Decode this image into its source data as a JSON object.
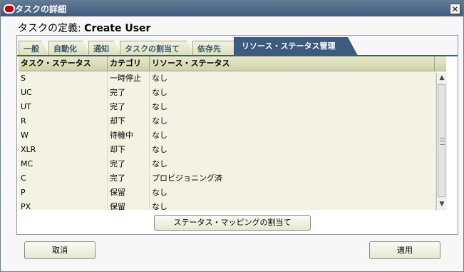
{
  "window": {
    "title": "タスクの詳細",
    "close_label": "×"
  },
  "heading": {
    "prefix": "タスクの定義: ",
    "name": "Create User"
  },
  "tabs": [
    {
      "label": "一般",
      "active": false
    },
    {
      "label": "自動化",
      "active": false
    },
    {
      "label": "通知",
      "active": false
    },
    {
      "label": "タスクの割当て",
      "active": false
    },
    {
      "label": "依存先",
      "active": false
    },
    {
      "label": "リソース・ステータス管理",
      "active": true
    }
  ],
  "table": {
    "columns": [
      "タスク・ステータス",
      "カテゴリ",
      "リソース・ステータス"
    ],
    "rows": [
      [
        "S",
        "一時停止",
        "なし"
      ],
      [
        "UC",
        "完了",
        "なし"
      ],
      [
        "UT",
        "完了",
        "なし"
      ],
      [
        "R",
        "却下",
        "なし"
      ],
      [
        "W",
        "待機中",
        "なし"
      ],
      [
        "XLR",
        "却下",
        "なし"
      ],
      [
        "MC",
        "完了",
        "なし"
      ],
      [
        "C",
        "完了",
        "プロビジョニング済"
      ],
      [
        "P",
        "保留",
        "なし"
      ],
      [
        "PX",
        "保留",
        "なし"
      ]
    ]
  },
  "buttons": {
    "status_mapping": "ステータス・マッピングの割当て",
    "cancel": "取消",
    "apply": "適用"
  },
  "scrollbar": {
    "up": "▲",
    "down": "▼"
  }
}
